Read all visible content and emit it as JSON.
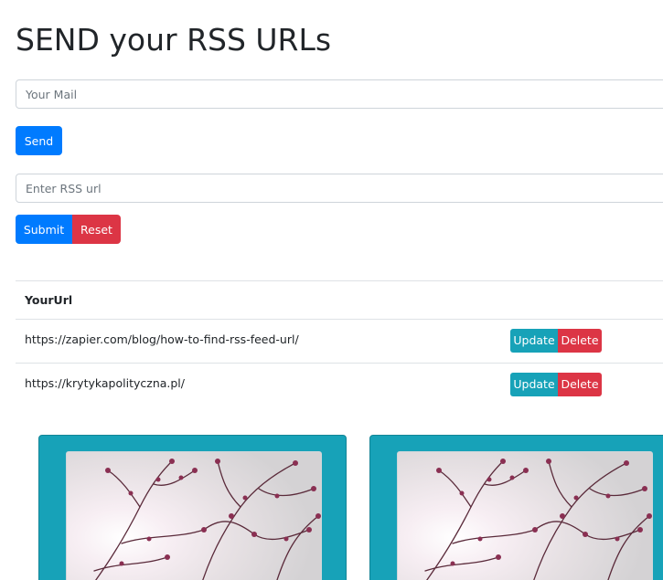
{
  "header": {
    "title": "SEND your RSS URLs"
  },
  "mail_form": {
    "placeholder": "Your Mail",
    "send_label": "Send"
  },
  "rss_form": {
    "placeholder": "Enter RSS url",
    "submit_label": "Submit",
    "reset_label": "Reset"
  },
  "table": {
    "header": "YourUrl",
    "rows": [
      {
        "url": "https://zapier.com/blog/how-to-find-rss-feed-url/",
        "update_label": "Update",
        "delete_label": "Delete"
      },
      {
        "url": "https://krytykapolityczna.pl/",
        "update_label": "Update",
        "delete_label": "Delete"
      }
    ]
  },
  "cards": [
    {
      "image": "blossom-tree-branches-photo"
    },
    {
      "image": "blossom-tree-branches-photo"
    }
  ],
  "colors": {
    "primary": "#007bff",
    "danger": "#dc3545",
    "info": "#17a2b8"
  }
}
